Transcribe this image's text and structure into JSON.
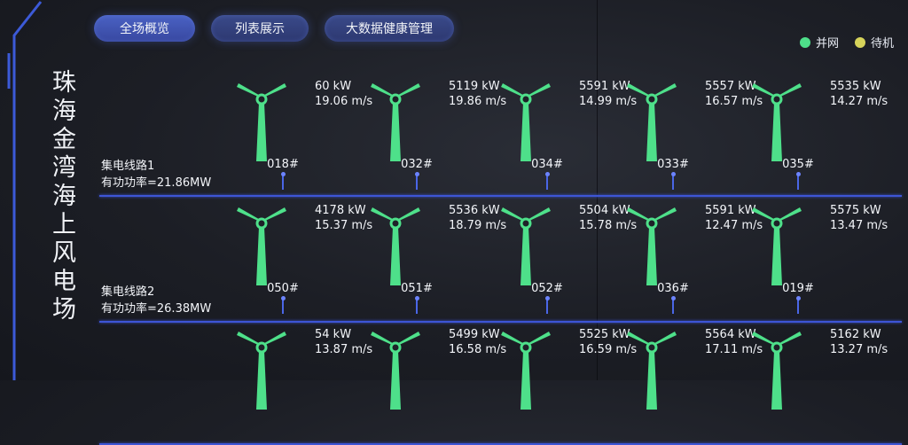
{
  "side_title": "珠海金湾海上风电场",
  "tabs": [
    {
      "label": "全场概览"
    },
    {
      "label": "列表展示"
    },
    {
      "label": "大数据健康管理"
    }
  ],
  "legend": [
    {
      "label": "并网",
      "color": "#4ee08a"
    },
    {
      "label": "待机",
      "color": "#d6d35a"
    }
  ],
  "colors": {
    "turbine_green": "#4ee08a",
    "feeder_line": "#3d55d6"
  },
  "feeders": [
    {
      "name": "集电线路1",
      "power": "有功功率=21.86MW",
      "turbines": [
        {
          "id": "018#",
          "power": "60 kW",
          "wind": "19.06 m/s"
        },
        {
          "id": "032#",
          "power": "5119 kW",
          "wind": "19.86 m/s"
        },
        {
          "id": "034#",
          "power": "5591 kW",
          "wind": "14.99 m/s"
        },
        {
          "id": "033#",
          "power": "5557 kW",
          "wind": "16.57 m/s"
        },
        {
          "id": "035#",
          "power": "5535 kW",
          "wind": "14.27 m/s"
        }
      ]
    },
    {
      "name": "集电线路2",
      "power": "有功功率=26.38MW",
      "turbines": [
        {
          "id": "050#",
          "power": "4178 kW",
          "wind": "15.37 m/s"
        },
        {
          "id": "051#",
          "power": "5536 kW",
          "wind": "18.79 m/s"
        },
        {
          "id": "052#",
          "power": "5504 kW",
          "wind": "15.78 m/s"
        },
        {
          "id": "036#",
          "power": "5591 kW",
          "wind": "12.47 m/s"
        },
        {
          "id": "019#",
          "power": "5575 kW",
          "wind": "13.47 m/s"
        }
      ]
    },
    {
      "name": "",
      "power": "",
      "turbines": [
        {
          "id": "",
          "power": "54 kW",
          "wind": "13.87 m/s"
        },
        {
          "id": "",
          "power": "5499 kW",
          "wind": "16.58 m/s"
        },
        {
          "id": "",
          "power": "5525 kW",
          "wind": "16.59 m/s"
        },
        {
          "id": "",
          "power": "5564 kW",
          "wind": "17.11 m/s"
        },
        {
          "id": "",
          "power": "5162 kW",
          "wind": "13.27 m/s"
        }
      ]
    }
  ]
}
